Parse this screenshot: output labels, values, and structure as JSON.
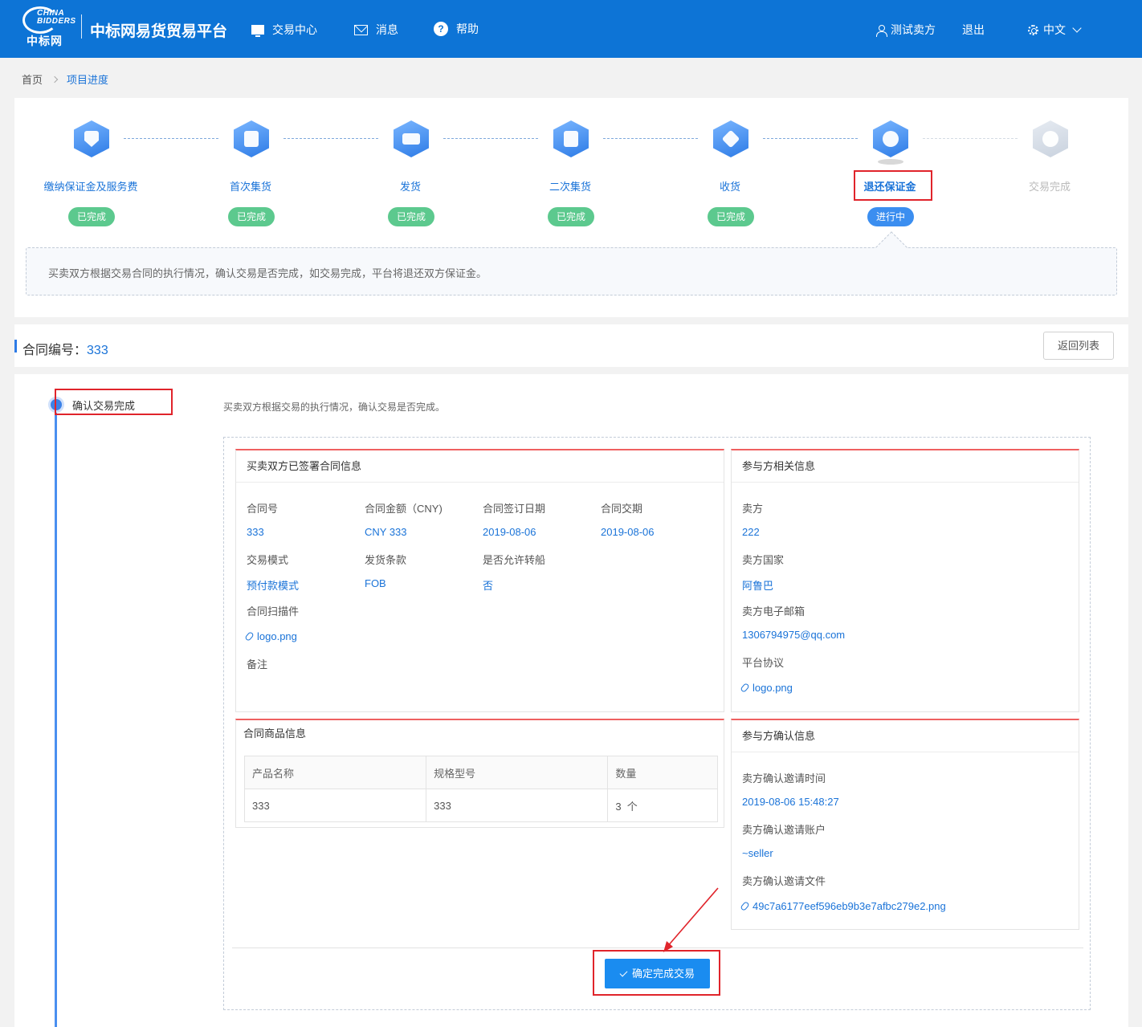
{
  "header": {
    "logo_en": "CHINA BIDDERS",
    "logo_cn": "中标网",
    "site_title": "中标网易货贸易平台",
    "nav": [
      {
        "label": "交易中心",
        "icon": "monitor-icon"
      },
      {
        "label": "消息",
        "icon": "mail-icon"
      },
      {
        "label": "帮助",
        "icon": "help-icon"
      }
    ],
    "help_glyph": "?",
    "user": "测试卖方",
    "logout": "退出",
    "language": "中文"
  },
  "breadcrumb": {
    "home": "首页",
    "current": "项目进度"
  },
  "steps": [
    {
      "label": "缴纳保证金及服务费",
      "status": "已完成",
      "icon": "shield-yen-icon"
    },
    {
      "label": "首次集货",
      "status": "已完成",
      "icon": "box-icon"
    },
    {
      "label": "发货",
      "status": "已完成",
      "icon": "truck-icon"
    },
    {
      "label": "二次集货",
      "status": "已完成",
      "icon": "box-icon"
    },
    {
      "label": "收货",
      "status": "已完成",
      "icon": "package-check-icon"
    },
    {
      "label": "退还保证金",
      "status": "进行中",
      "icon": "refund-icon"
    },
    {
      "label": "交易完成",
      "status": "",
      "icon": "check-icon"
    }
  ],
  "step_info": "买卖双方根据交易合同的执行情况，确认交易是否完成，如交易完成，平台将退还双方保证金。",
  "contract": {
    "label": "合同编号：",
    "number": "333",
    "back_button": "返回列表"
  },
  "phase": {
    "title": "确认交易完成",
    "description": "买卖双方根据交易的执行情况，确认交易是否完成。"
  },
  "contract_info": {
    "title": "买卖双方已签署合同信息",
    "fields": [
      {
        "label": "合同号",
        "value": "333"
      },
      {
        "label": "合同金额（CNY)",
        "value": "CNY 333"
      },
      {
        "label": "合同签订日期",
        "value": "2019-08-06"
      },
      {
        "label": "合同交期",
        "value": "2019-08-06"
      },
      {
        "label": "交易模式",
        "value": "预付款模式"
      },
      {
        "label": "发货条款",
        "value": "FOB"
      },
      {
        "label": "是否允许转船",
        "value": "否"
      }
    ],
    "scan_label": "合同扫描件",
    "scan_file": "logo.png",
    "remark_label": "备注"
  },
  "party_info": {
    "title": "参与方相关信息",
    "seller_label": "卖方",
    "seller": "222",
    "country_label": "卖方国家",
    "country": "阿鲁巴",
    "email_label": "卖方电子邮箱",
    "email": "1306794975@qq.com",
    "agreement_label": "平台协议",
    "agreement_file": "logo.png"
  },
  "goods": {
    "title": "合同商品信息",
    "headers": [
      "产品名称",
      "规格型号",
      "数量"
    ],
    "rows": [
      [
        "333",
        "333",
        "3  个"
      ]
    ]
  },
  "confirm_info": {
    "title": "参与方确认信息",
    "time_label": "卖方确认邀请时间",
    "time": "2019-08-06 15:48:27",
    "account_label": "卖方确认邀请账户",
    "account": "~seller",
    "file_label": "卖方确认邀请文件",
    "file": "49c7a6177eef596eb9b3e7afbc279e2.png"
  },
  "confirm_button": "确定完成交易",
  "colors": {
    "brand": "#0d74d6",
    "done": "#5cc98e",
    "active": "#3b8ef0",
    "highlight": "#e0242b"
  }
}
